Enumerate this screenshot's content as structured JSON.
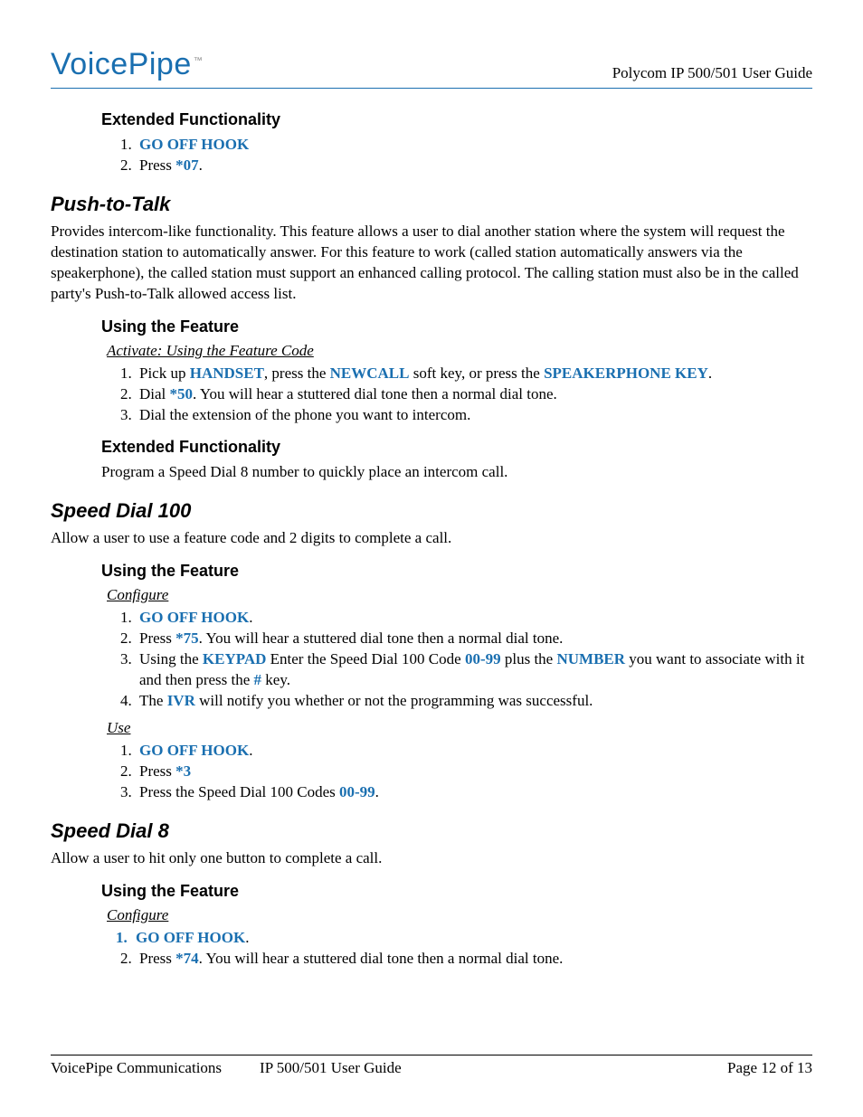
{
  "header": {
    "logo_text": "VoicePipe",
    "logo_tm": "™",
    "right_text": "Polycom IP 500/501 User Guide"
  },
  "sections": {
    "ext1": {
      "heading": "Extended Functionality",
      "item1_emph": "GO OFF HOOK",
      "item2_pre": "Press ",
      "item2_emph": "*07",
      "item2_post": "."
    },
    "ptt": {
      "heading": "Push-to-Talk",
      "intro": "Provides intercom-like functionality.  This feature allows a user to dial another station where the system will request the destination station to automatically answer.  For this feature to work (called station automatically answers via the speakerphone), the called station must support an enhanced calling protocol.  The calling station must also be in the called party's Push-to-Talk allowed access list.",
      "using_heading": "Using the Feature",
      "activate_heading": "Activate: Using the Feature Code",
      "s1_pre": "Pick up ",
      "s1_e1": "HANDSET",
      "s1_mid1": ", press the ",
      "s1_e2": "NEWCALL",
      "s1_mid2": " soft key, or press the ",
      "s1_e3": "SPEAKERPHONE KEY",
      "s1_post": ".",
      "s2_pre": "Dial ",
      "s2_e": "*50",
      "s2_post": ".  You will hear a stuttered dial tone then a normal dial tone.",
      "s3": "Dial the extension of the phone you want to intercom.",
      "ext_heading": "Extended Functionality",
      "ext_body": "Program a Speed Dial 8 number to quickly place an intercom call."
    },
    "sd100": {
      "heading": "Speed Dial 100",
      "intro": "Allow a user to use a feature code and 2 digits to complete a call.",
      "using_heading": "Using the Feature",
      "configure_heading": "Configure",
      "c1_e": "GO OFF HOOK",
      "c1_post": ".",
      "c2_pre": "Press ",
      "c2_e": "*75",
      "c2_post": ". You will hear a stuttered dial tone then a normal dial tone.",
      "c3_pre": "Using the ",
      "c3_e1": "KEYPAD",
      "c3_mid1": " Enter the Speed Dial 100 Code ",
      "c3_e2": "00-99",
      "c3_mid2": " plus the ",
      "c3_e3": "NUMBER",
      "c3_mid3": " you want to associate with it and then press the ",
      "c3_e4": "#",
      "c3_post": " key.",
      "c4_pre": "The ",
      "c4_e": "IVR",
      "c4_post": " will notify you whether or not the programming was successful.",
      "use_heading": "Use",
      "u1_e": "GO OFF HOOK",
      "u1_post": ".",
      "u2_pre": "Press ",
      "u2_e": "*3",
      "u3_pre": "Press the Speed Dial 100 Codes ",
      "u3_e": "00-99",
      "u3_post": "."
    },
    "sd8": {
      "heading": "Speed Dial 8",
      "intro": "Allow a user to hit only one button to complete a call.",
      "using_heading": "Using the Feature",
      "configure_heading": "Configure",
      "c1_e": "GO OFF HOOK",
      "c1_post": ".",
      "c2_pre": "Press ",
      "c2_e": "*74",
      "c2_post": ". You will hear a stuttered dial tone then a normal dial tone."
    }
  },
  "footer": {
    "left": "VoicePipe Communications",
    "center": "IP 500/501 User Guide",
    "right": "Page 12 of 13"
  }
}
